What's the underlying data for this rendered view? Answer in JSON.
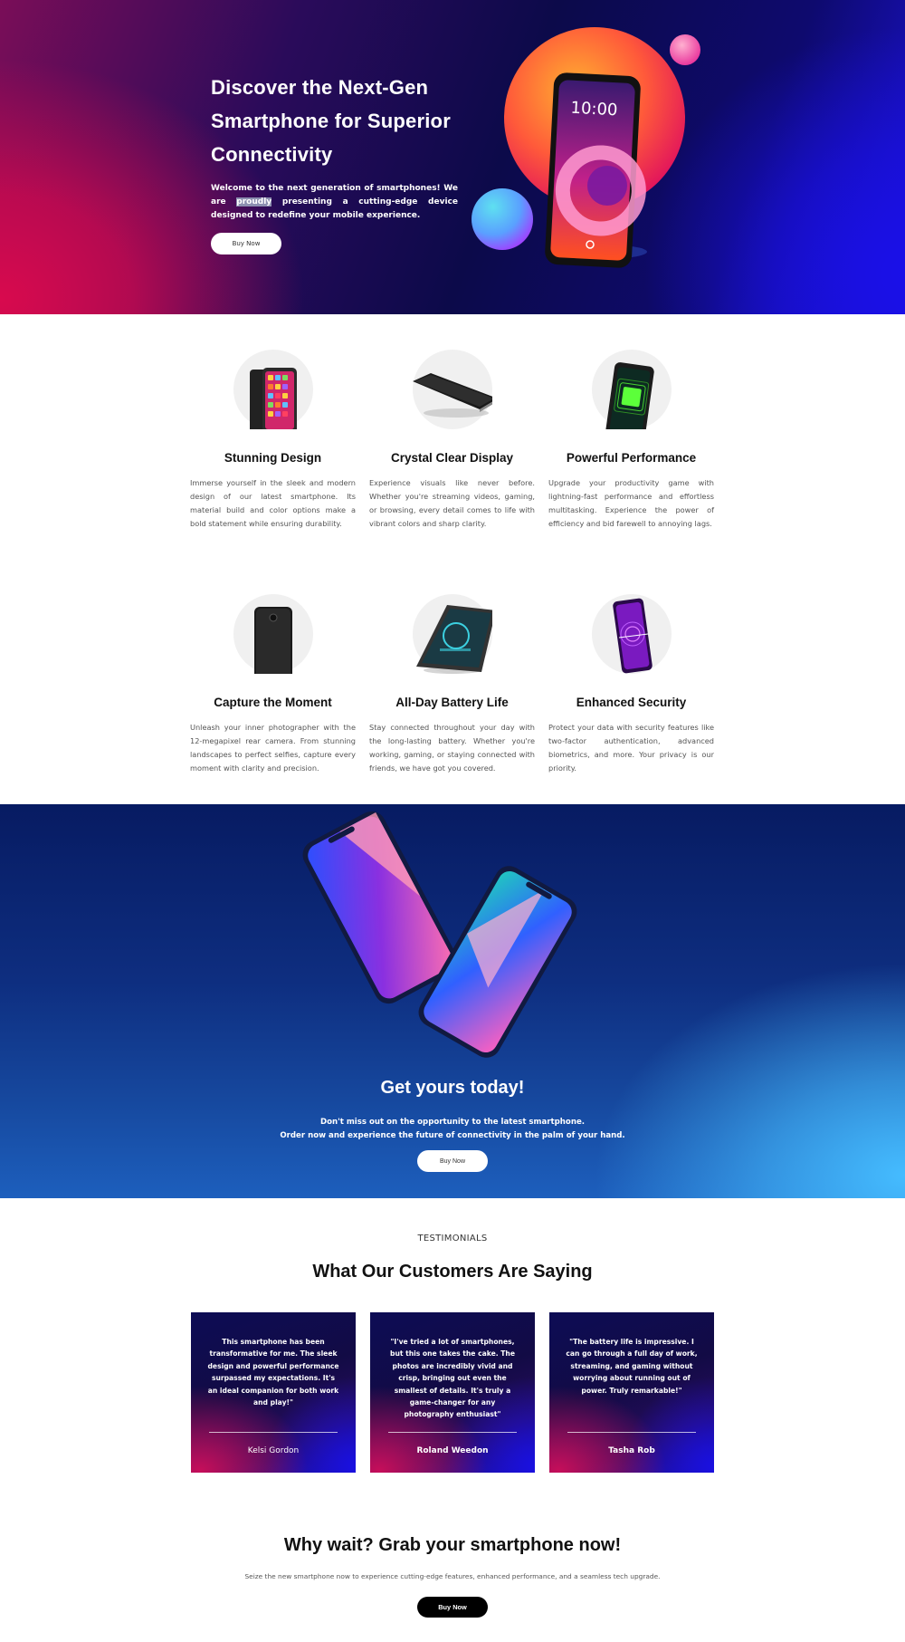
{
  "hero": {
    "title": "Discover the Next-Gen Smartphone for Superior Connectivity",
    "description_before": "Welcome to the next generation of smartphones! We are ",
    "description_highlight": "proudly",
    "description_after": " presenting a cutting-edge device designed to redefine your mobile experience.",
    "button_label": "Buy Now",
    "phone_time": "10:00"
  },
  "features": [
    {
      "title": "Stunning Design",
      "text": "Immerse yourself in the sleek and modern design of our latest smartphone. Its material build and color options make a bold statement while ensuring durability."
    },
    {
      "title": "Crystal Clear Display",
      "text": "Experience visuals like never before. Whether you're streaming videos, gaming, or browsing, every detail comes to life with vibrant colors and sharp clarity."
    },
    {
      "title": "Powerful Performance",
      "text": "Upgrade your productivity game with lightning-fast performance and effortless multitasking. Experience the power of efficiency and bid farewell to annoying lags."
    },
    {
      "title": "Capture the Moment",
      "text": "Unleash your inner photographer with the 12-megapixel rear camera. From stunning landscapes to perfect selfies, capture every moment with clarity and precision."
    },
    {
      "title": "All-Day Battery Life",
      "text": "Stay connected throughout your day with the long-lasting battery. Whether you're working, gaming, or staying connected with friends, we have got you covered."
    },
    {
      "title": "Enhanced Security",
      "text": "Protect your data with security features like two-factor authentication, advanced biometrics, and more. Your privacy is our priority."
    }
  ],
  "cta": {
    "title": "Get yours today!",
    "line1": "Don't miss out on the opportunity to the latest smartphone.",
    "line2": "Order now and experience the future of connectivity in the palm of your hand.",
    "button_label": "Buy Now"
  },
  "testimonials": {
    "kicker": "TESTIMONIALS",
    "title": "What Our Customers Are Saying",
    "cards": [
      {
        "quote": "This smartphone has been transformative for me. The sleek design and powerful performance surpassed my expectations. It's an ideal companion for both work and play!\"",
        "author": "Kelsi Gordon"
      },
      {
        "quote": "\"I've tried a lot of smartphones, but this one takes the cake. The photos are incredibly vivid and crisp, bringing out even the smallest of details.  It's truly a game-changer for any photography enthusiast\"",
        "author": "Roland Weedon"
      },
      {
        "quote": "\"The battery life is impressive. I can go through a full day of work, streaming, and gaming without worrying about running out of power. Truly remarkable!\"",
        "author": "Tasha Rob"
      }
    ]
  },
  "final": {
    "title": "Why wait? Grab your smartphone now!",
    "subtitle": "Seize the new smartphone now to experience cutting-edge features, enhanced performance, and a seamless tech upgrade.",
    "button_label": "Buy Now"
  }
}
